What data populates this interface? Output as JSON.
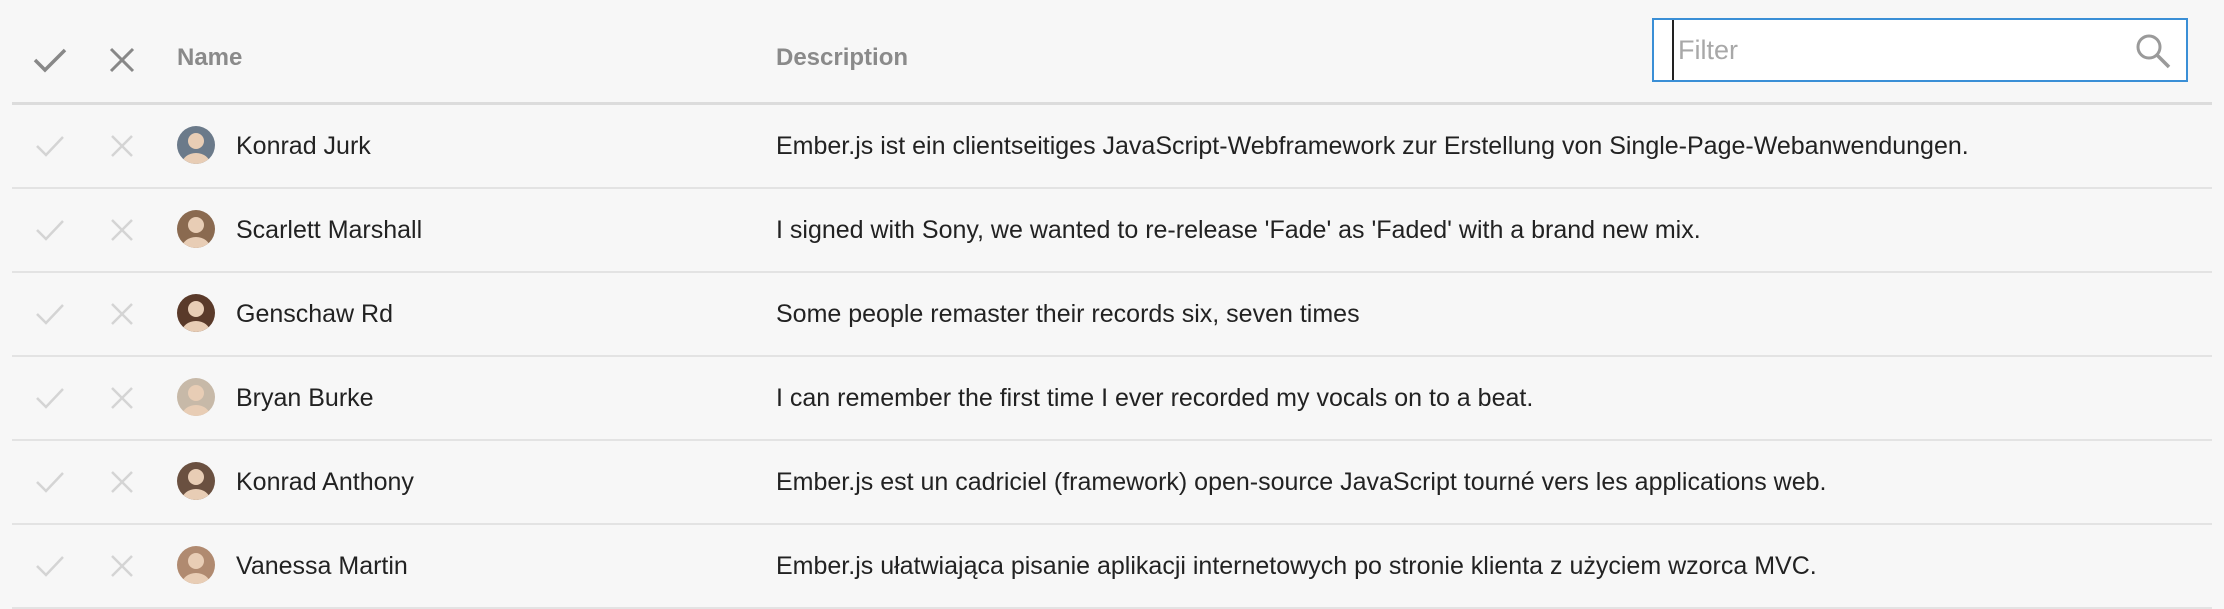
{
  "header": {
    "name_label": "Name",
    "description_label": "Description",
    "accept_all_icon": "check-icon",
    "reject_all_icon": "x-icon"
  },
  "filter": {
    "placeholder": "Filter",
    "value": "",
    "icon": "search-icon",
    "border_color": "#3a8fd6"
  },
  "rows": [
    {
      "name": "Konrad Jurk",
      "description": "Ember.js ist ein clientseitiges JavaScript-Webframework zur Erstellung von Single-Page-Webanwendungen.",
      "avatar_color": "#6b7a8a"
    },
    {
      "name": "Scarlett Marshall",
      "description": "I signed with Sony, we wanted to re-release 'Fade' as 'Faded' with a brand new mix.",
      "avatar_color": "#8a6a50"
    },
    {
      "name": "Genschaw Rd",
      "description": "Some people remaster their records six, seven times",
      "avatar_color": "#5a3a2a"
    },
    {
      "name": "Bryan Burke",
      "description": "I can remember the first time I ever recorded my vocals on to a beat.",
      "avatar_color": "#c7b9a8"
    },
    {
      "name": "Konrad Anthony",
      "description": "Ember.js est un cadriciel (framework) open-source JavaScript tourné vers les applications web.",
      "avatar_color": "#6a5040"
    },
    {
      "name": "Vanessa Martin",
      "description": "Ember.js ułatwiająca pisanie aplikacji internetowych po stronie klienta z użyciem wzorca MVC.",
      "avatar_color": "#b08a70"
    }
  ]
}
